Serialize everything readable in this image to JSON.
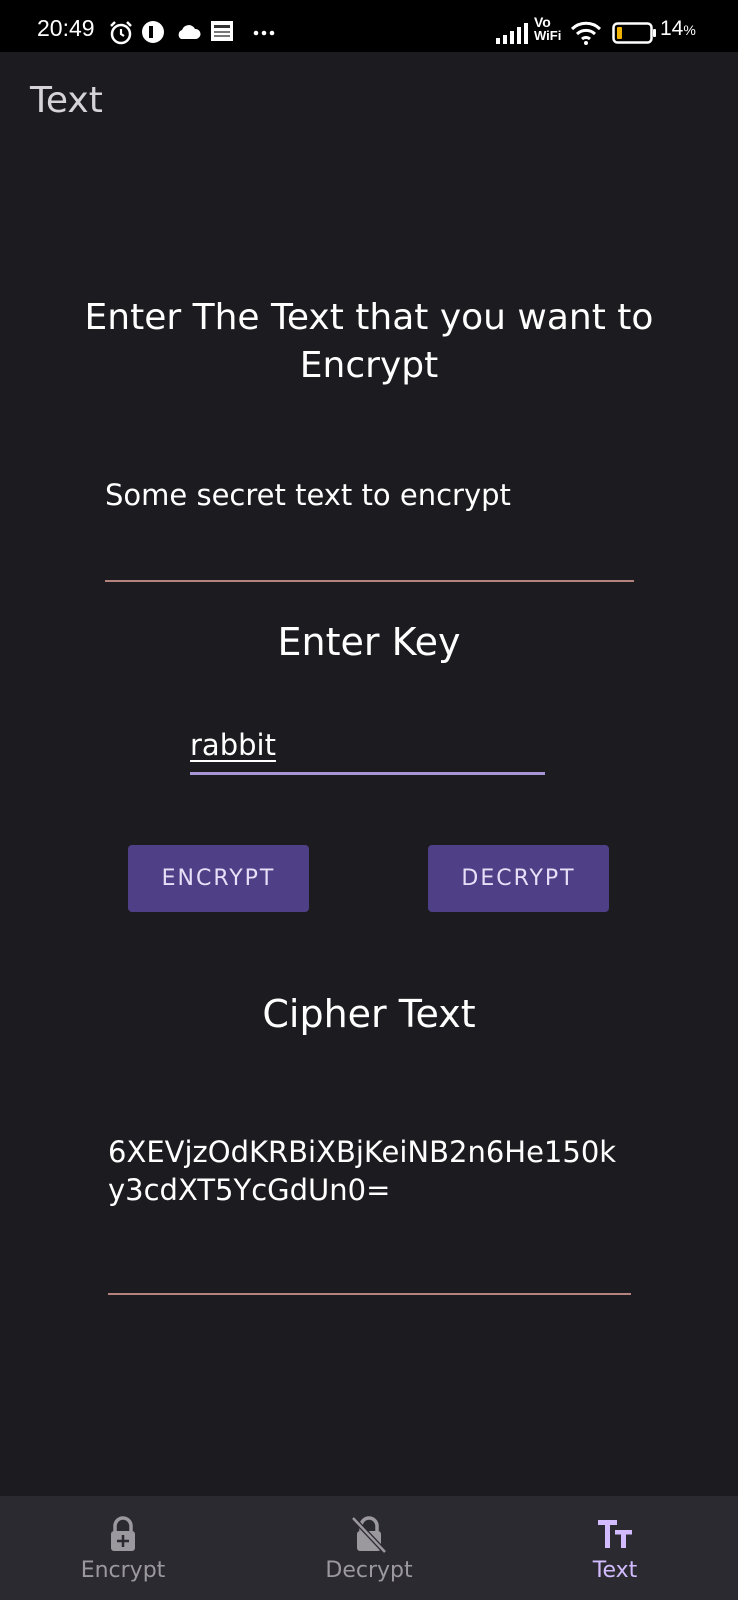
{
  "status_bar": {
    "time": "20:49",
    "battery_percent": "14",
    "battery_unit": "%",
    "icons": [
      "alarm-icon",
      "app-notification-icon",
      "cloud-icon",
      "news-icon",
      "more-dots-icon",
      "signal-icon",
      "vowifi-icon",
      "wifi-icon",
      "battery-icon"
    ],
    "vowifi_top": "Vo",
    "vowifi_bottom": "WiFi"
  },
  "app_bar": {
    "title": "Text"
  },
  "main": {
    "plain_heading": "Enter The Text that you want to Encrypt",
    "plain_value": "Some secret text to encrypt",
    "key_heading": "Enter Key",
    "key_value": "rabbit",
    "encrypt_label": "ENCRYPT",
    "decrypt_label": "DECRYPT",
    "cipher_heading": "Cipher Text",
    "cipher_value": "6XEVjzOdKRBiXBjKeiNB2n6He150ky3cdXT5YcGdUn0="
  },
  "bottom_nav": {
    "items": [
      {
        "label": "Encrypt",
        "icon": "lock-add-icon",
        "active": false
      },
      {
        "label": "Decrypt",
        "icon": "lock-off-icon",
        "active": false
      },
      {
        "label": "Text",
        "icon": "text-fields-icon",
        "active": true
      }
    ]
  },
  "colors": {
    "background": "#1c1b1f",
    "button": "#4f3f86",
    "active_nav": "#d2bcff",
    "field_underline": "#b5837e",
    "key_underline": "#a796d6"
  }
}
